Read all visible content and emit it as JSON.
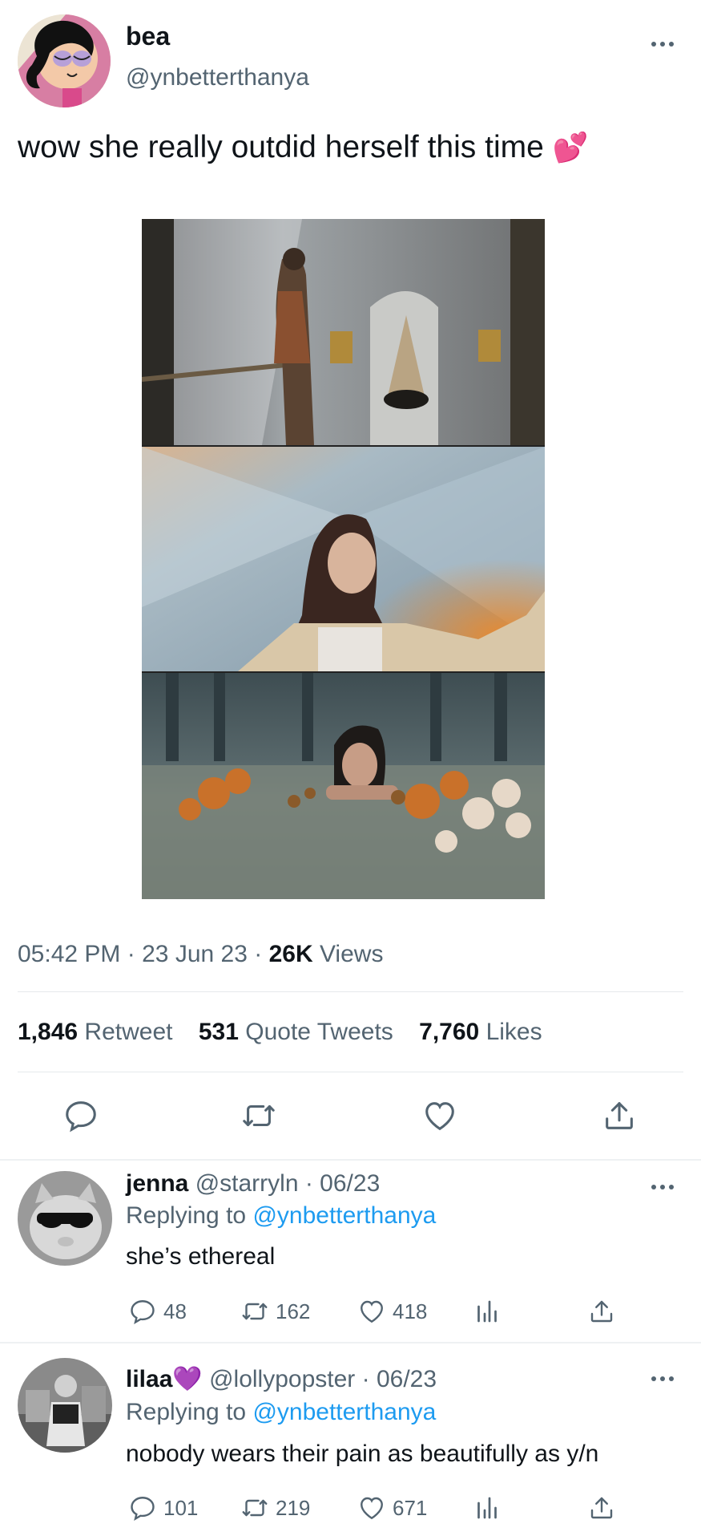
{
  "tweet": {
    "author_name": "bea",
    "author_handle": "@ynbetterthanya",
    "text": "wow she really outdid herself this time",
    "emoji": "💕",
    "time": "05:42 PM",
    "date": "23 Jun 23",
    "views_count": "26K",
    "views_label": "Views",
    "retweets_count": "1,846",
    "retweets_label": "Retweet",
    "quotes_count": "531",
    "quotes_label": "Quote Tweets",
    "likes_count": "7,760",
    "likes_label": "Likes",
    "sep": "·"
  },
  "actions": {
    "reply_icon": "reply-icon",
    "retweet_icon": "retweet-icon",
    "like_icon": "heart-icon",
    "share_icon": "share-icon"
  },
  "replies": [
    {
      "name": "jenna",
      "handle": "@starryln",
      "date": "· 06/23",
      "replying_prefix": "Replying to",
      "replying_to": "@ynbetterthanya",
      "text": "she’s ethereal",
      "replies": "48",
      "retweets": "162",
      "likes": "418"
    },
    {
      "name": "lilaa",
      "name_emoji": "💜",
      "handle": "@lollypopster",
      "date": "· 06/23",
      "replying_prefix": "Replying to",
      "replying_to": "@ynbetterthanya",
      "text": "nobody wears their pain as beautifully as y/n",
      "replies": "101",
      "retweets": "219",
      "likes": "671"
    }
  ],
  "colors": {
    "link": "#1d9bf0",
    "muted": "#536471",
    "text": "#0f1419"
  }
}
